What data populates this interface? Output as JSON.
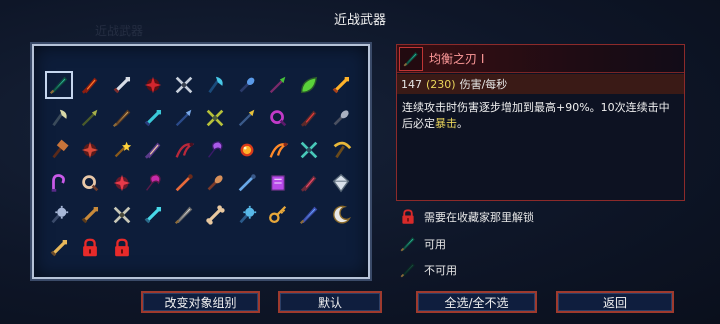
{
  "header": {
    "title": "近战武器",
    "ghost_title": "近战武器"
  },
  "grid": {
    "rows": [
      [
        {
          "name": "balanced-blade-icon",
          "c1": "#2fb59a",
          "c2": "#0c4a3c",
          "shape": "blade",
          "selected": true
        },
        {
          "name": "flame-dagger-icon",
          "c1": "#ff7a2a",
          "c2": "#8a1d10",
          "shape": "dagger"
        },
        {
          "name": "broadsword-icon",
          "c1": "#d8dde6",
          "c2": "#7a2a2a",
          "shape": "sword"
        },
        {
          "name": "blood-sword-icon",
          "c1": "#d2262e",
          "c2": "#5a0f14",
          "shape": "burst"
        },
        {
          "name": "twin-daggers-icon",
          "c1": "#c8d0dc",
          "c2": "#3a4250",
          "shape": "cross"
        },
        {
          "name": "frost-blade-icon",
          "c1": "#48c8e8",
          "c2": "#1a4a7a",
          "shape": "axe"
        },
        {
          "name": "shovel-icon",
          "c1": "#5a9ae8",
          "c2": "#2a3a6a",
          "shape": "shovel"
        },
        {
          "name": "poison-spear-icon",
          "c1": "#46c23a",
          "c2": "#7a2a6a",
          "shape": "spear"
        },
        {
          "name": "leaf-blade-icon",
          "c1": "#5ad23a",
          "c2": "#2a5a2a",
          "shape": "leaf"
        },
        {
          "name": "fire-brand-icon",
          "c1": "#ffb32a",
          "c2": "#a8401a",
          "shape": "sword"
        }
      ],
      [
        {
          "name": "oven-axe-icon",
          "c1": "#d8d8a8",
          "c2": "#3a4a5a",
          "shape": "axe"
        },
        {
          "name": "war-pike-icon",
          "c1": "#a8b04a",
          "c2": "#4a5a2a",
          "shape": "spear"
        },
        {
          "name": "rapier-icon",
          "c1": "#c8a060",
          "c2": "#5a3a20",
          "shape": "blade"
        },
        {
          "name": "frantic-sword-icon",
          "c1": "#3ac8d8",
          "c2": "#2a3a7a",
          "shape": "sword"
        },
        {
          "name": "ice-spear-icon",
          "c1": "#78a8e8",
          "c2": "#2a4a8a",
          "shape": "spear"
        },
        {
          "name": "thorn-blade-icon",
          "c1": "#b8c23a",
          "c2": "#4a5a3a",
          "shape": "cross"
        },
        {
          "name": "gold-trident-icon",
          "c1": "#e8c23a",
          "c2": "#3a5a8a",
          "shape": "spear"
        },
        {
          "name": "scythe-claw-icon",
          "c1": "#c23ac8",
          "c2": "#5a1a6a",
          "shape": "ring"
        },
        {
          "name": "red-lance-icon",
          "c1": "#e83a3a",
          "c2": "#5a2a2a",
          "shape": "dagger"
        },
        {
          "name": "bone-club-icon",
          "c1": "#a8b0c0",
          "c2": "#4a5060",
          "shape": "club"
        }
      ],
      [
        {
          "name": "hammer-icon",
          "c1": "#c8743a",
          "c2": "#5a2a1a",
          "shape": "hammer"
        },
        {
          "name": "bull-horn-icon",
          "c1": "#d84a3a",
          "c2": "#5a1a1a",
          "shape": "burst"
        },
        {
          "name": "magic-wand-icon",
          "c1": "#ffd23a",
          "c2": "#8a5a1a",
          "shape": "wand"
        },
        {
          "name": "assassin-dagger-icon",
          "c1": "#e8c8a0",
          "c2": "#5a3a8a",
          "shape": "dagger"
        },
        {
          "name": "chain-whip-icon",
          "c1": "#b8283a",
          "c2": "#4a1020",
          "shape": "whip"
        },
        {
          "name": "purple-sickle-icon",
          "c1": "#a85ae8",
          "c2": "#3a1a6a",
          "shape": "sickle"
        },
        {
          "name": "fire-orb-icon",
          "c1": "#ffb32a",
          "c2": "#d83a1a",
          "shape": "orb"
        },
        {
          "name": "flame-whip-icon",
          "c1": "#ff8a2a",
          "c2": "#8a2a1a",
          "shape": "whip"
        },
        {
          "name": "spiked-shield-icon",
          "c1": "#48c8b8",
          "c2": "#2a4a5a",
          "shape": "cross"
        },
        {
          "name": "pickaxe-icon",
          "c1": "#e8b83a",
          "c2": "#6a4a1a",
          "shape": "pick"
        }
      ],
      [
        {
          "name": "crowbar-icon",
          "c1": "#c85ae8",
          "c2": "#5a2a8a",
          "shape": "hook"
        },
        {
          "name": "magnifier-icon",
          "c1": "#e8c8a8",
          "c2": "#6a3a2a",
          "shape": "ring"
        },
        {
          "name": "cursed-tome-icon",
          "c1": "#e83a4a",
          "c2": "#6a1a2a",
          "shape": "burst"
        },
        {
          "name": "tentacle-icon",
          "c1": "#c82aa8",
          "c2": "#5a1a4a",
          "shape": "sickle"
        },
        {
          "name": "bamboo-staff-icon",
          "c1": "#e86a3a",
          "c2": "#6a2a1a",
          "shape": "staff"
        },
        {
          "name": "ham-bat-icon",
          "c1": "#d8905a",
          "c2": "#7a3a2a",
          "shape": "club"
        },
        {
          "name": "rod-icon",
          "c1": "#68a8e8",
          "c2": "#3a5a8a",
          "shape": "staff"
        },
        {
          "name": "spell-book-icon",
          "c1": "#b84ae8",
          "c2": "#4a2a6a",
          "shape": "book"
        },
        {
          "name": "gauntlet-icon",
          "c1": "#e84a6a",
          "c2": "#6a2a3a",
          "shape": "dagger"
        },
        {
          "name": "bell-icon",
          "c1": "#d8e0ea",
          "c2": "#5a6a7a",
          "shape": "gem"
        }
      ],
      [
        {
          "name": "mace-icon",
          "c1": "#a8b8d8",
          "c2": "#3a4a6a",
          "shape": "mace"
        },
        {
          "name": "hand-axe-icon",
          "c1": "#c88a3a",
          "c2": "#5a3a1a",
          "shape": "sword"
        },
        {
          "name": "crossed-swords-icon",
          "c1": "#c8c8b8",
          "c2": "#4a4a3a",
          "shape": "cross"
        },
        {
          "name": "crystal-sword-icon",
          "c1": "#48d8e8",
          "c2": "#2a6a8a",
          "shape": "sword"
        },
        {
          "name": "steel-rapier-icon",
          "c1": "#d8d8d8",
          "c2": "#6a6a6a",
          "shape": "blade"
        },
        {
          "name": "bone-icon",
          "c1": "#e8c8a0",
          "c2": "#8a6a4a",
          "shape": "bone"
        },
        {
          "name": "ice-pillar-icon",
          "c1": "#58b8e8",
          "c2": "#2a5a8a",
          "shape": "mace"
        },
        {
          "name": "golden-key-icon",
          "c1": "#e8a83a",
          "c2": "#7a4a1a",
          "shape": "key"
        },
        {
          "name": "ice-fang-icon",
          "c1": "#68a8ff",
          "c2": "#3a4aa8",
          "shape": "blade"
        },
        {
          "name": "moon-blade-icon",
          "c1": "#e8e8e8",
          "c2": "#8a6a2a",
          "shape": "moon"
        }
      ],
      [
        {
          "name": "old-sword-icon",
          "c1": "#e8b85a",
          "c2": "#6a4a2a",
          "shape": "sword"
        },
        {
          "name": "locked-weapon-icon",
          "c1": "#e82a2a",
          "c2": "#5a0a0a",
          "shape": "lock"
        },
        {
          "name": "locked-weapon-icon",
          "c1": "#e82a2a",
          "c2": "#5a0a0a",
          "shape": "lock"
        }
      ]
    ]
  },
  "detail": {
    "icon": {
      "name": "balanced-blade-icon",
      "c1": "#2fb59a",
      "c2": "#0c4a3c"
    },
    "name": "均衡之刃 I",
    "dps_base": "147",
    "dps_bonus": "(230)",
    "dps_label": "伤害/每秒",
    "description_main": "连续攻击时伤害逐步增加到最高+90%。10次连续击中后必定",
    "description_crit": "暴击",
    "description_end": "。"
  },
  "legend": {
    "locked": "需要在收藏家那里解锁",
    "available": "可用",
    "unavailable": "不可用",
    "lock_color": "#d82a2a",
    "available_color": "#2fb59a",
    "unavailable_color": "#1c4a40"
  },
  "buttons": {
    "change_group": "改变对象组别",
    "default": "默认",
    "select_all": "全选/全不选",
    "back": "返回"
  }
}
